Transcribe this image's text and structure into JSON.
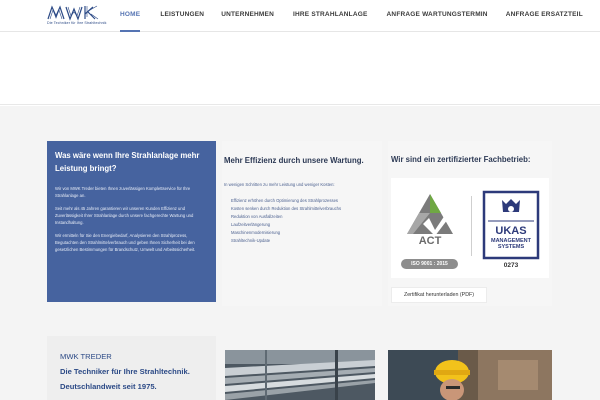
{
  "logo": {
    "text": "mwk",
    "tagline": "Die Techniker für Ihre Strahltechnik"
  },
  "nav": {
    "items": [
      {
        "label": "HOME",
        "active": true
      },
      {
        "label": "LEISTUNGEN",
        "active": false
      },
      {
        "label": "UNTERNEHMEN",
        "active": false
      },
      {
        "label": "IHRE STRAHLANLAGE",
        "active": false
      },
      {
        "label": "ANFRAGE WARTUNGSTERMIN",
        "active": false
      },
      {
        "label": "ANFRAGE ERSATZTEIL",
        "active": false
      }
    ]
  },
  "blue_card": {
    "title": "Was wäre wenn Ihre Strahlanlage mehr Leistung bringt?",
    "paragraphs": [
      "Wir von MWK Treder bieten Ihnen zuverlässigen Komplettservice für Ihre Strahlanlage an.",
      "Seit mehr als 45 Jahren garantieren wir unseren Kunden Effizienz und Zuverlässigkeit Ihrer Strahlanlage durch unsere fachgerechte Wartung und Instandhaltung.",
      "Wir ermitteln für Sie den Energiebedarf, Analysieren den Strahlprozess, Begutachten den Strahlmittelverbrauch und geben Ihnen Sicherheit bei den gesetzlichen Bestimmungen für Brandschutz, Umwelt und Arbeitssicherheit."
    ]
  },
  "efficiency": {
    "title": "Mehr Effizienz durch unsere Wartung.",
    "intro": "In wenigen Schritten zu mehr Leistung und weniger Kosten:",
    "items": [
      "Effizienz erhöhen durch Optimierung des Strahlprozesses",
      "Kosten senken durch Reduktion des Strahlmittelverbrauchs",
      "Reduktion von Ausfallzeiten",
      "Laufzeitverlängerung",
      "Maschinenmodernisierung",
      "Strahltechnik-Update"
    ]
  },
  "certification": {
    "title": "Wir sind ein zertifizierter Fachbetrieb:",
    "act_label": "ACT",
    "iso_label": "ISO 9001 : 2015",
    "ukas_lines": [
      "UKAS",
      "MANAGEMENT",
      "SYSTEMS"
    ],
    "ukas_number": "0273",
    "download_label": "Zertifikat herunterladen (PDF)"
  },
  "treder": {
    "line1": "MWK TREDER",
    "line2": "Die Techniker für Ihre Strahltechnik.",
    "line3": "Deutschlandweit seit 1975."
  },
  "colors": {
    "brand_blue": "#46639f",
    "nav_active": "#5574b3",
    "heading_dark": "#2d3a55"
  }
}
